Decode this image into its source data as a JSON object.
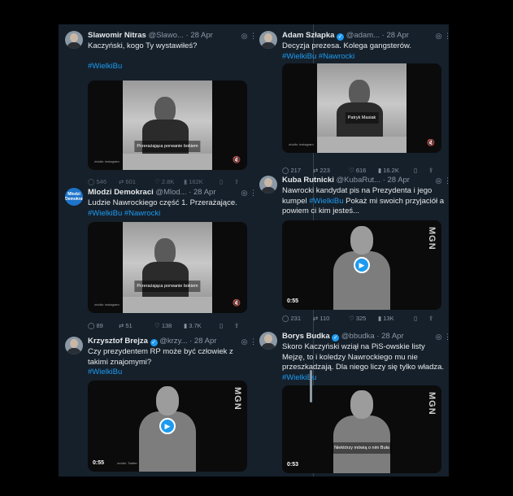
{
  "tweets": [
    {
      "name": "Slawomir Nitras",
      "handle": "@Slawo...",
      "time": "· 28 Apr",
      "verified": false,
      "text": "Kaczyński, kogo Ty wystawiłeś?",
      "hashtags": "#WielkiBu",
      "media": {
        "kind": "photo",
        "caption": "Przerażająca porwanie bokiem",
        "source": "źródło: instagram"
      },
      "replies": "546",
      "reposts": "601",
      "likes": "2.8K",
      "views": "162K"
    },
    {
      "name": "Adam Szłapka",
      "handle": "@adam...",
      "time": "· 28 Apr",
      "verified": true,
      "text": "Decyzja prezesa. Kolega gangsterów.",
      "hashtags": "#WielkiBu #Nawrocki",
      "media": {
        "kind": "photo",
        "caption": "Patryk Masiak",
        "source": "źródło: instagram"
      },
      "replies": "217",
      "reposts": "223",
      "likes": "616",
      "views": "16.2K"
    },
    {
      "name": "Mlodzi Demokraci",
      "handle": "@Mlod...",
      "time": "· 28 Apr",
      "verified": false,
      "avatar_text": "Młodzi Demokraci",
      "text": "Ludzie Nawrockiego część 1. Przerażające.",
      "hashtags": "#WielkiBu #Nawrocki",
      "media": {
        "kind": "photo",
        "caption": "Przerażająca porwanie bokiem",
        "source": "źródło: instagram"
      },
      "replies": "89",
      "reposts": "51",
      "likes": "138",
      "views": "3.7K"
    },
    {
      "name": "Kuba Rutnicki",
      "handle": "@KubaRut...",
      "time": "· 28 Apr",
      "verified": false,
      "text_pre": "Nawrocki kandydat pis na Prezydenta i jego kumpel ",
      "text_hash": "#WielkiBu",
      "text_post": " Pokaż mi swoich przyjaciół a powiem ci kim jesteś...",
      "media": {
        "kind": "video",
        "duration": "0:55",
        "brand": "MGN"
      },
      "replies": "231",
      "reposts": "110",
      "likes": "325",
      "views": "13K"
    },
    {
      "name": "Krzysztof Brejza",
      "handle": "@krzy...",
      "time": "· 28 Apr",
      "verified": true,
      "text": "Czy prezydentem RP może być człowiek z takimi znajomymi?",
      "hashtags": "#WielkiBu",
      "media": {
        "kind": "video",
        "duration": "0:55",
        "brand": "MGN",
        "source": "źródło: Twitter"
      }
    },
    {
      "name": "Borys Budka",
      "handle": "@bbudka",
      "time": "· 28 Apr",
      "verified": true,
      "text_pre": "Skoro Kaczyński wziął na PiS-owskie listy Mejzę, to i koledzy Nawrockiego mu nie przeszkadzają. Dla niego liczy się tylko władza. ",
      "text_hash": "#WielkiBu",
      "text_post": "",
      "media": {
        "kind": "video",
        "duration": "0:53",
        "brand": "MGN",
        "caption": "Niektórzy mówią o nim Buła"
      }
    }
  ],
  "icons": {
    "grok": "grok-icon",
    "more": "more-icon",
    "reply": "reply-icon",
    "repost": "repost-icon",
    "like": "like-icon",
    "views": "views-icon",
    "bookmark": "bookmark-icon",
    "share": "share-icon",
    "play": "play-icon",
    "mute": "mute-icon"
  },
  "colors": {
    "background": "#15202b",
    "accent": "#1d9bf0",
    "muted": "#8b98a5"
  }
}
